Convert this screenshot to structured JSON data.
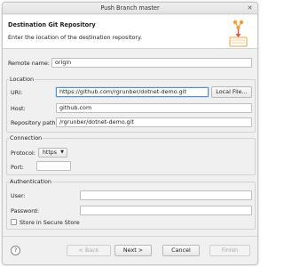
{
  "window": {
    "title": "Push Branch master",
    "close_glyph": "✕"
  },
  "header": {
    "title": "Destination Git Repository",
    "description": "Enter the location of the destination repository.",
    "icon": "git-push-wizard-icon"
  },
  "remote_name": {
    "label": "Remote name:",
    "value": "origin"
  },
  "location": {
    "title": "Location",
    "uri_label": "URI:",
    "uri_value": "https://github.com/rgrunber/dotnet-demo.git",
    "local_file_button": "Local File...",
    "host_label": "Host:",
    "host_value": "github.com",
    "repo_path_label": "Repository path:",
    "repo_path_value": "/rgrunber/dotnet-demo.git"
  },
  "connection": {
    "title": "Connection",
    "protocol_label": "Protocol:",
    "protocol_value": "https",
    "port_label": "Port:",
    "port_value": ""
  },
  "authentication": {
    "title": "Authentication",
    "user_label": "User:",
    "user_value": "",
    "password_label": "Password:",
    "password_value": "",
    "store_label": "Store in Secure Store",
    "store_checked": false
  },
  "footer": {
    "help_glyph": "?",
    "back_button": "< Back",
    "next_button": "Next >",
    "cancel_button": "Cancel",
    "finish_button": "Finish"
  },
  "colors": {
    "focus_border": "#5b8fd1",
    "icon_orange": "#f0a030",
    "icon_red": "#e05050"
  }
}
